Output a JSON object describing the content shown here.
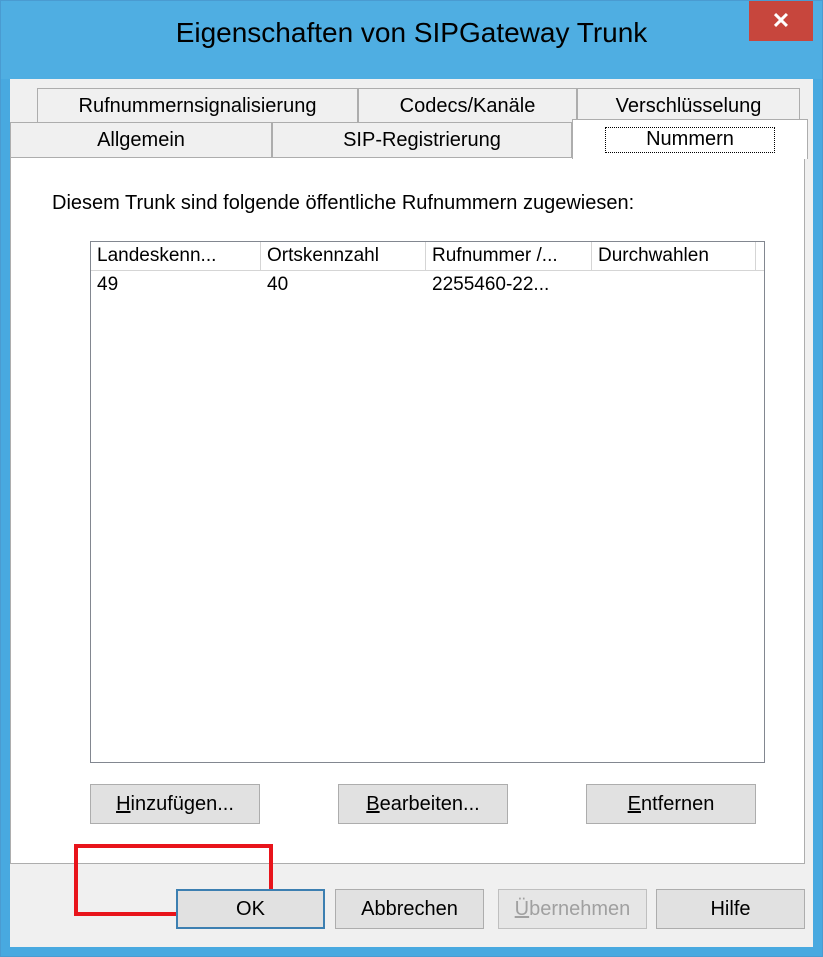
{
  "window": {
    "title": "Eigenschaften von SIPGateway Trunk",
    "close_glyph": "✕"
  },
  "tabs": {
    "row_top": [
      "Rufnummernsignalisierung",
      "Codecs/Kanäle",
      "Verschlüsselung"
    ],
    "row_bottom": [
      "Allgemein",
      "SIP-Registrierung",
      "Nummern"
    ],
    "active": "Nummern"
  },
  "panel": {
    "description": "Diesem Trunk sind folgende öffentliche Rufnummern zugewiesen:",
    "columns": [
      "Landeskenn...",
      "Ortskennzahl",
      "Rufnummer /...",
      "Durchwahlen"
    ],
    "rows": [
      [
        "49",
        "40",
        "2255460-22...",
        ""
      ]
    ],
    "buttons": {
      "add_accel": "H",
      "add_rest": "inzufügen...",
      "edit_accel": "B",
      "edit_rest": "earbeiten...",
      "remove_accel": "E",
      "remove_rest": "ntfernen"
    }
  },
  "dialog_buttons": {
    "ok": "OK",
    "cancel": "Abbrechen",
    "apply_accel": "Ü",
    "apply_rest": "bernehmen",
    "help": "Hilfe"
  },
  "colors": {
    "titlebar": "#4faee2",
    "close": "#c7463d",
    "highlight": "#e8141b"
  }
}
